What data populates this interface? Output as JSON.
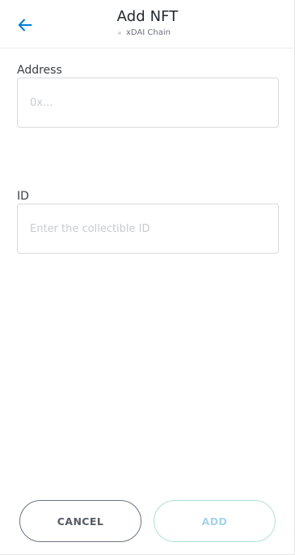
{
  "header": {
    "title": "Add NFT",
    "network_name": "xDAI Chain",
    "back_icon": "arrow-left-icon",
    "accent_color": "#037dd6"
  },
  "form": {
    "address": {
      "label": "Address",
      "value": "",
      "placeholder": "0x..."
    },
    "id": {
      "label": "ID",
      "value": "",
      "placeholder": "Enter the collectible ID"
    }
  },
  "actions": {
    "cancel_label": "CANCEL",
    "add_label": "ADD",
    "add_enabled": false
  }
}
